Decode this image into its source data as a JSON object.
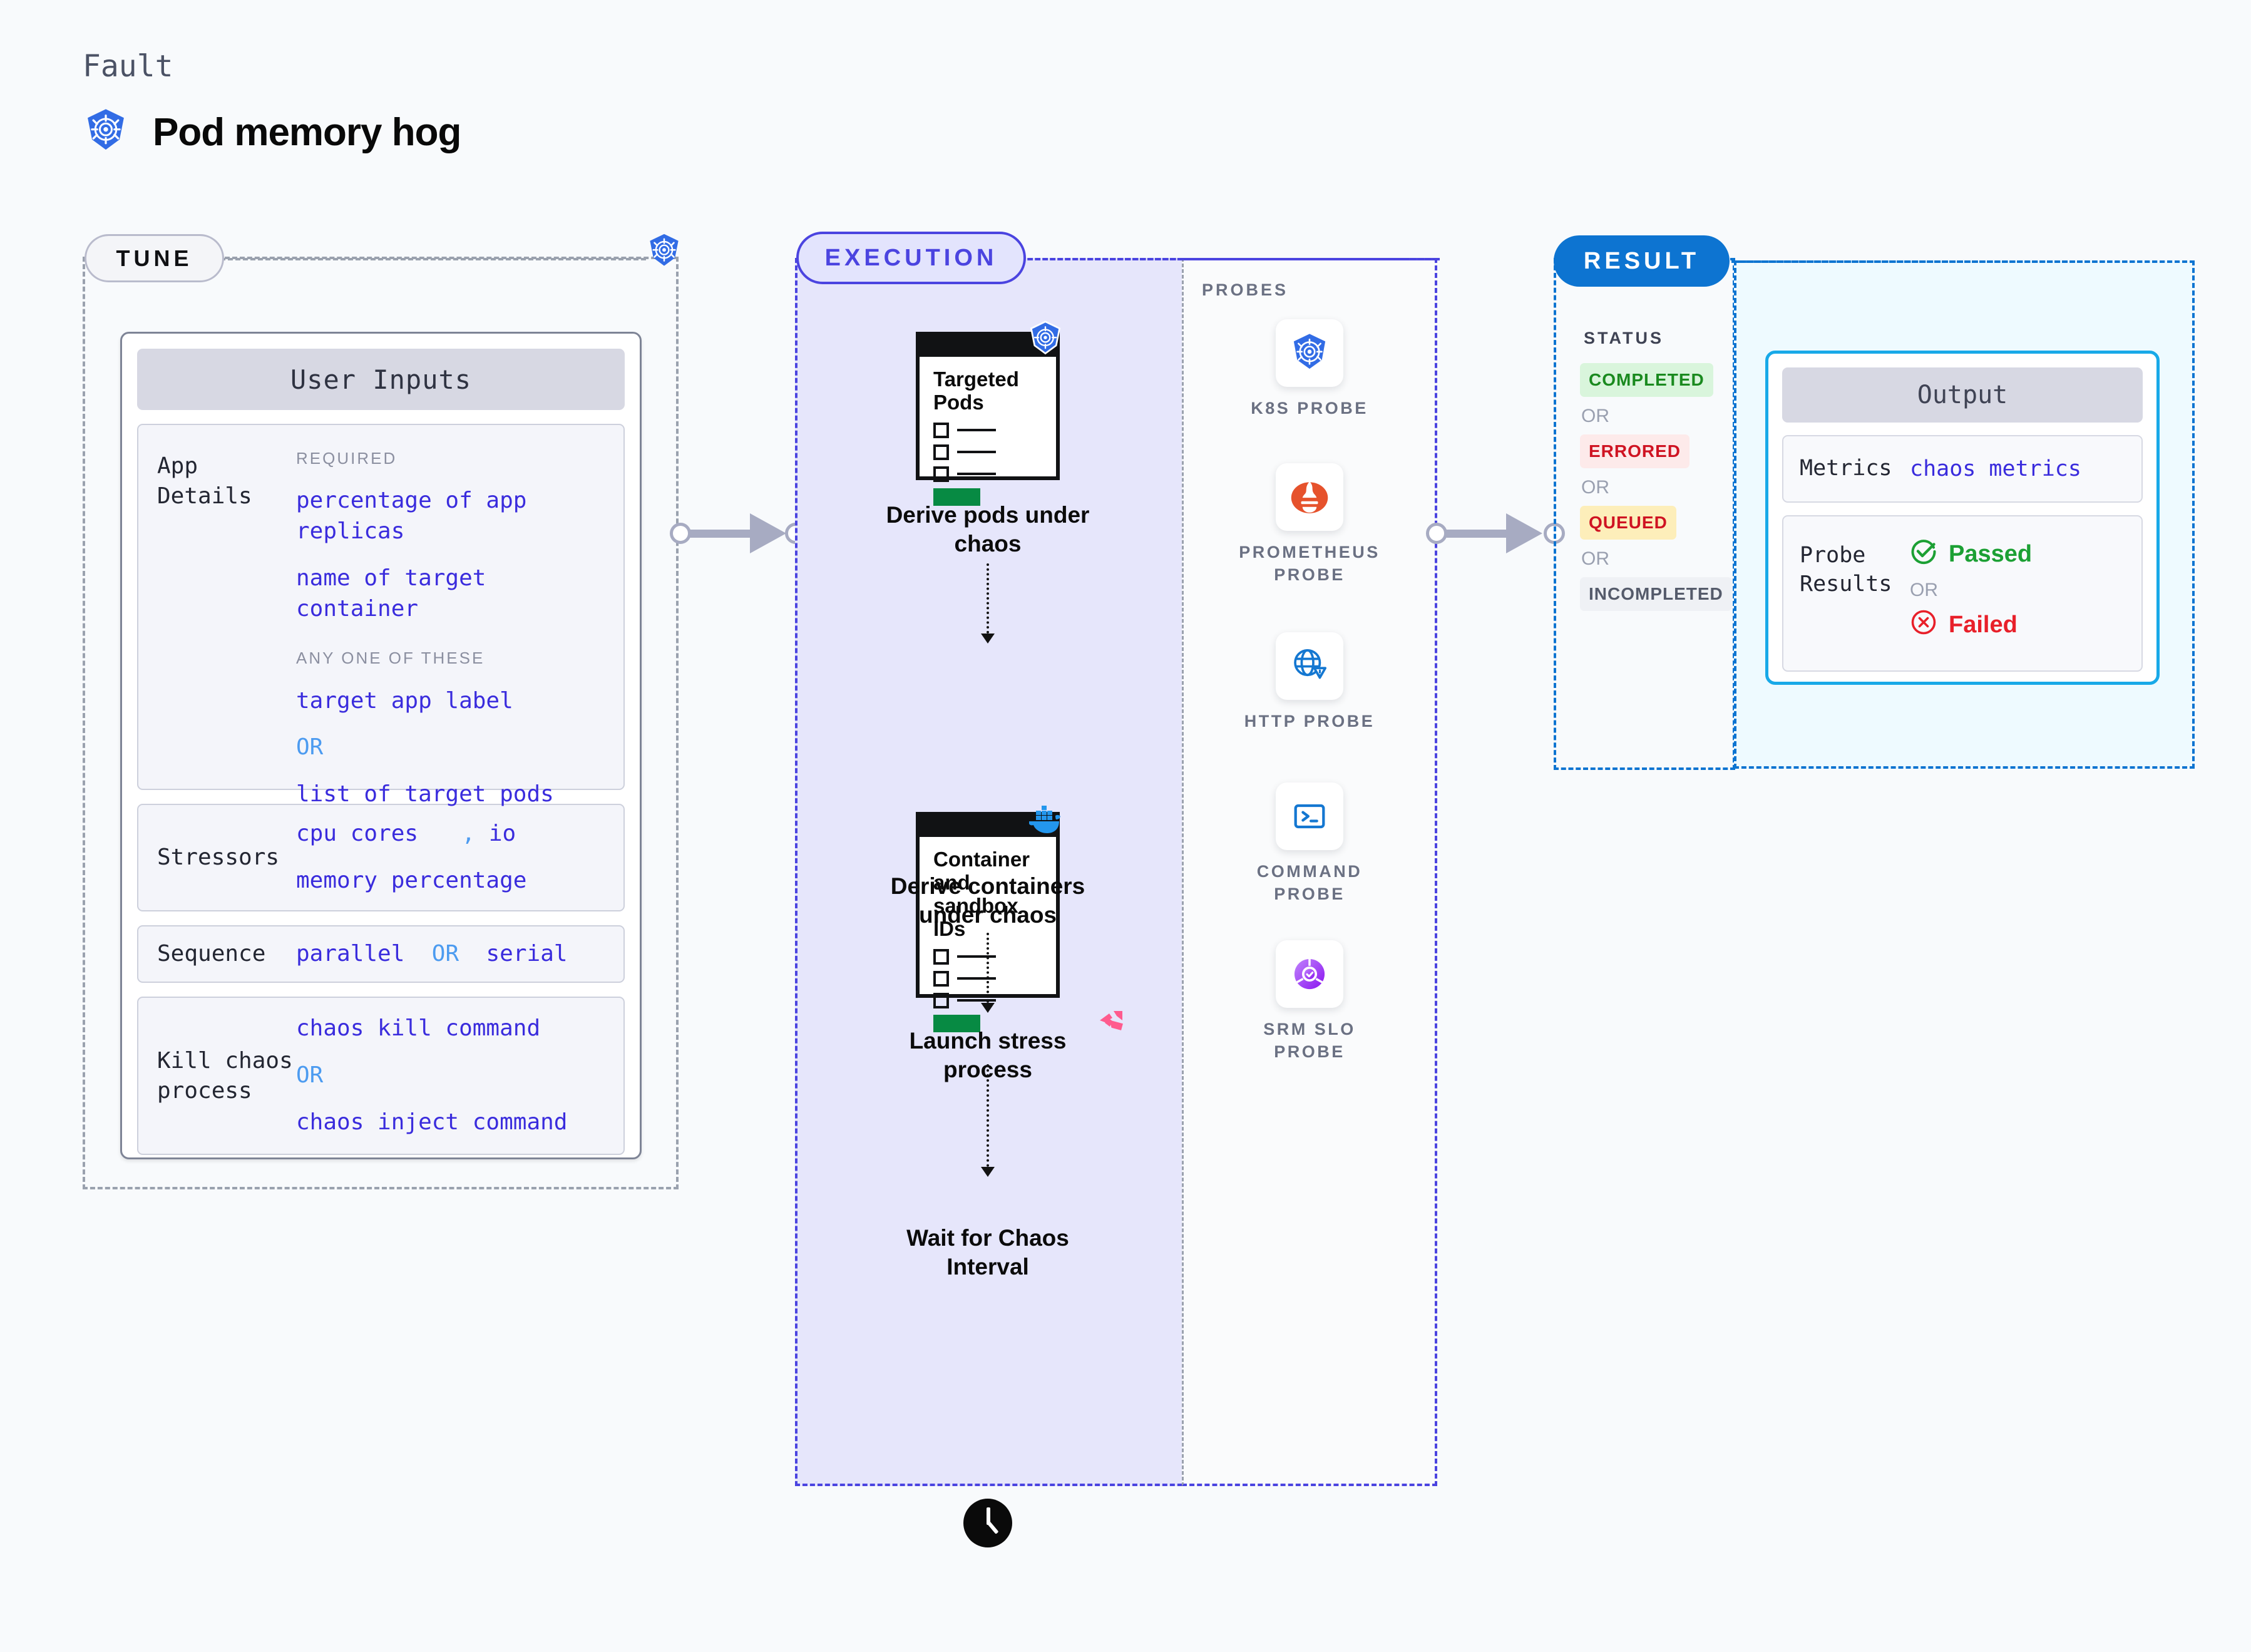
{
  "header": {
    "kicker": "Fault",
    "title": "Pod memory hog",
    "icon": "kubernetes-icon"
  },
  "stages": {
    "tune": {
      "label": "TUNE",
      "edge_icon": "kubernetes-icon"
    },
    "execution": {
      "label": "EXECUTION"
    },
    "result": {
      "label": "RESULT"
    }
  },
  "tune": {
    "card_title": "User Inputs",
    "rows": [
      {
        "label": "App Details",
        "groups": [
          {
            "hint": "REQUIRED",
            "items": [
              "percentage of app replicas",
              "name of target container"
            ]
          },
          {
            "hint": "ANY ONE OF THESE",
            "items": [
              "target app label",
              "OR",
              "list of target pods"
            ]
          }
        ]
      },
      {
        "label": "Stressors",
        "values": [
          "cpu cores",
          ",",
          "io",
          "memory percentage"
        ]
      },
      {
        "label": "Sequence",
        "values": [
          "parallel",
          "OR",
          "serial"
        ]
      },
      {
        "label": "Kill chaos process",
        "values": [
          "chaos kill command",
          "OR",
          "chaos inject command"
        ]
      }
    ]
  },
  "execution": {
    "steps": [
      {
        "caption": "Derive pods under chaos",
        "card_title": "Targeted Pods",
        "badge_icon": "kubernetes-icon"
      },
      {
        "caption": "Derive containers under chaos",
        "card_title": "Container and sandbox IDs",
        "badge_icon": "docker-icon"
      },
      {
        "caption": "Launch stress process",
        "badge_icon": "harness-icon"
      },
      {
        "caption": "Wait for Chaos Interval",
        "icon": "clock-icon"
      }
    ]
  },
  "probes": {
    "title": "PROBES",
    "items": [
      {
        "label": "K8S PROBE",
        "icon": "kubernetes-icon"
      },
      {
        "label": "PROMETHEUS PROBE",
        "icon": "prometheus-icon"
      },
      {
        "label": "HTTP PROBE",
        "icon": "globe-warning-icon"
      },
      {
        "label": "COMMAND PROBE",
        "icon": "terminal-icon"
      },
      {
        "label": "SRM SLO PROBE",
        "icon": "srm-slo-icon"
      }
    ]
  },
  "result": {
    "status_title": "STATUS",
    "statuses": [
      {
        "label": "COMPLETED",
        "bg": "#d9f5dc",
        "fg": "#1a8a1f"
      },
      {
        "label": "OR",
        "separator": true
      },
      {
        "label": "ERRORED",
        "bg": "#fdeaea",
        "fg": "#cf1322"
      },
      {
        "label": "OR",
        "separator": true
      },
      {
        "label": "QUEUED",
        "bg": "#fdeeba",
        "fg": "#cf1322"
      },
      {
        "label": "OR",
        "separator": true
      },
      {
        "label": "INCOMPLETED",
        "bg": "#eff1f5",
        "fg": "#555b6b"
      }
    ]
  },
  "output": {
    "card_title": "Output",
    "rows": [
      {
        "label": "Metrics",
        "value": "chaos metrics"
      },
      {
        "label": "Probe Results",
        "passed": "Passed",
        "or": "OR",
        "failed": "Failed",
        "passed_color": "#1ca034",
        "failed_color": "#e8202a"
      }
    ]
  },
  "colors": {
    "accent_indigo": "#4b44e0",
    "accent_blue": "#0d74d1",
    "value_blue": "#3a2cdd",
    "or_blue": "#4c9bf0",
    "exec_fill": "#e6e6fb",
    "output_fill": "#eefaff"
  }
}
